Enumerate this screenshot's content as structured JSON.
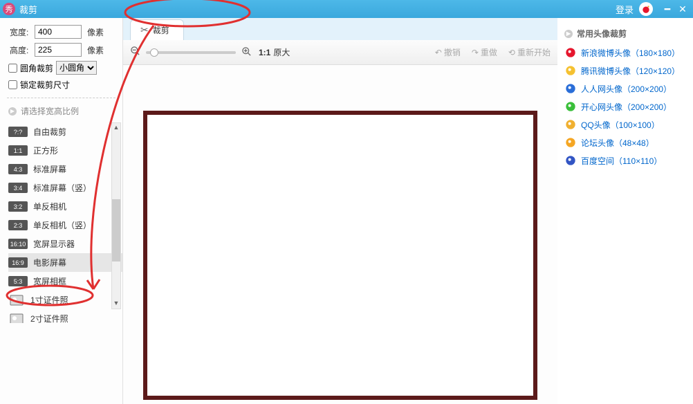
{
  "titlebar": {
    "app_name": "裁剪",
    "login_label": "登录"
  },
  "left": {
    "width_label": "宽度:",
    "width_value": "400",
    "height_label": "高度:",
    "height_value": "225",
    "pixel_unit": "像素",
    "round_crop_label": "圆角裁剪",
    "round_option": "小圆角",
    "lock_size_label": "锁定裁剪尺寸",
    "ratio_title": "请选择宽高比例",
    "ratios": [
      {
        "badge": "?:?",
        "label": "自由裁剪"
      },
      {
        "badge": "1:1",
        "label": "正方形"
      },
      {
        "badge": "4:3",
        "label": "标准屏幕"
      },
      {
        "badge": "3:4",
        "label": "标准屏幕（竖）"
      },
      {
        "badge": "3:2",
        "label": "单反相机"
      },
      {
        "badge": "2:3",
        "label": "单反相机（竖）"
      },
      {
        "badge": "16:10",
        "label": "宽屏显示器"
      },
      {
        "badge": "16:9",
        "label": "电影屏幕"
      },
      {
        "badge": "5:3",
        "label": "宽屏相框"
      },
      {
        "badge": "",
        "label": "1寸证件照"
      },
      {
        "badge": "",
        "label": "2寸证件照"
      }
    ],
    "selected_ratio_index": 7
  },
  "center": {
    "tab_label": "裁剪",
    "zoom_1_1": "1:1",
    "zoom_full": "原大",
    "undo": "撤销",
    "redo": "重做",
    "restart": "重新开始"
  },
  "right": {
    "title": "常用头像裁剪",
    "presets": [
      {
        "icon_color": "#e6162d",
        "label": "新浪微博头像（180×180）"
      },
      {
        "icon_color": "#f5c131",
        "label": "腾讯微博头像（120×120）"
      },
      {
        "icon_color": "#2a6ed8",
        "label": "人人网头像（200×200）"
      },
      {
        "icon_color": "#3abf3a",
        "label": "开心网头像（200×200）"
      },
      {
        "icon_color": "#f0b030",
        "label": "QQ头像（100×100）"
      },
      {
        "icon_color": "#f5a623",
        "label": "论坛头像（48×48）"
      },
      {
        "icon_color": "#3255c4",
        "label": "百度空间（110×110）"
      }
    ]
  }
}
